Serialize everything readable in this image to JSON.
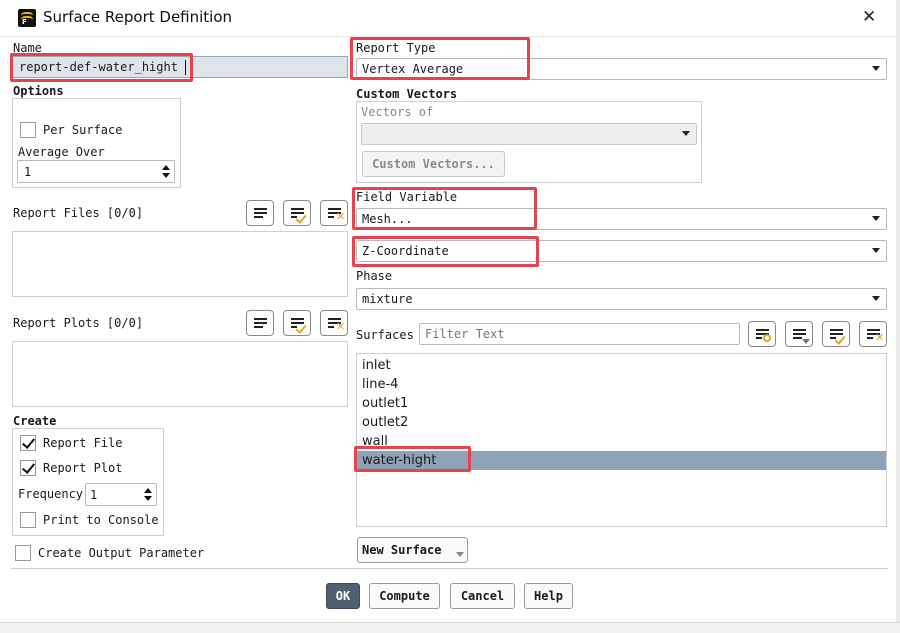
{
  "window": {
    "title": "Surface Report Definition",
    "close_glyph": "✕",
    "app_icon": "fluent-app-icon"
  },
  "name": {
    "label": "Name",
    "value": "report-def-water_hight"
  },
  "options": {
    "label": "Options",
    "per_surface": {
      "label": "Per Surface",
      "checked": false
    },
    "average_over": {
      "label": "Average Over",
      "value": "1"
    }
  },
  "report_files": {
    "label": "Report Files [0/0]"
  },
  "report_plots": {
    "label": "Report Plots [0/0]"
  },
  "create": {
    "label": "Create",
    "report_file": {
      "label": "Report File",
      "checked": true
    },
    "report_plot": {
      "label": "Report Plot",
      "checked": true
    },
    "frequency": {
      "label": "Frequency",
      "value": "1"
    },
    "print_to_console": {
      "label": "Print to Console",
      "checked": false
    }
  },
  "create_output_parameter": {
    "label": "Create Output Parameter",
    "checked": false
  },
  "report_type": {
    "label": "Report Type",
    "value": "Vertex Average"
  },
  "custom_vectors": {
    "label": "Custom Vectors",
    "vectors_of_label": "Vectors of",
    "vectors_of_value": "",
    "button_label": "Custom Vectors..."
  },
  "field_variable": {
    "label": "Field Variable",
    "category": "Mesh...",
    "variable": "Z-Coordinate"
  },
  "phase": {
    "label": "Phase",
    "value": "mixture"
  },
  "surfaces": {
    "label": "Surfaces",
    "filter_placeholder": "Filter Text",
    "items": [
      "inlet",
      "line-4",
      "outlet1",
      "outlet2",
      "wall",
      "water-hight"
    ],
    "selected": "water-hight"
  },
  "new_surface": {
    "label": "New Surface"
  },
  "footer": {
    "ok": "OK",
    "compute": "Compute",
    "cancel": "Cancel",
    "help": "Help"
  },
  "colors": {
    "highlight": "#e8434d",
    "selection": "#8fa3b6",
    "ok_button": "#51606e"
  }
}
